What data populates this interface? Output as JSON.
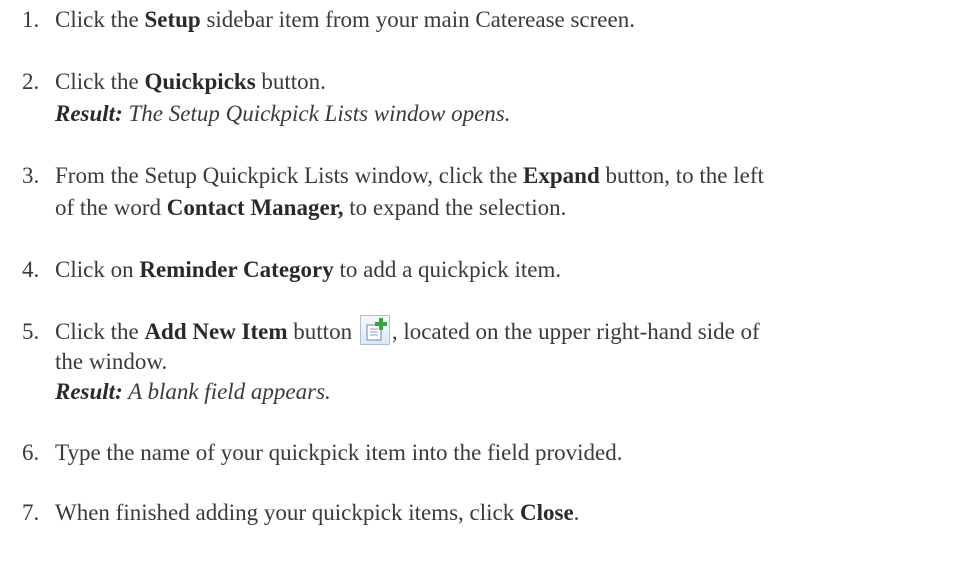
{
  "steps": [
    {
      "num": "1.",
      "pre": "Click the ",
      "bold": "Setup",
      "post": " sidebar item from your main Caterease screen."
    },
    {
      "num": "2.",
      "pre": "Click the ",
      "bold": "Quickpicks",
      "post": " button.",
      "result_label": "Result:",
      "result_text": " The Setup Quickpick Lists window opens."
    },
    {
      "num": "3.",
      "pre": "From the Setup Quickpick Lists window, click the ",
      "bold": "Expand",
      "post": " button, to the left",
      "line2_pre": "of the word ",
      "line2_bold": "Contact Manager,",
      "line2_post": " to expand the selection."
    },
    {
      "num": "4.",
      "pre": "Click on ",
      "bold": "Reminder Category",
      "post": " to add a quickpick item."
    },
    {
      "num": "5.",
      "pre": "Click the ",
      "bold": "Add New Item",
      "post_before_icon": " button ",
      "post": ", located on the upper right-hand side of",
      "line2": "the window.",
      "result_label": "Result:",
      "result_text": " A blank field appears."
    },
    {
      "num": "6.",
      "text": "Type the name of your quickpick item into the field provided."
    },
    {
      "num": "7.",
      "pre": "When finished adding your quickpick items, click ",
      "bold": "Close",
      "post": "."
    }
  ],
  "icons": {
    "add_new_item": "add-new-item-icon"
  },
  "colors": {
    "text": "#3a3a3a",
    "icon_plus": "#3aa63a"
  }
}
